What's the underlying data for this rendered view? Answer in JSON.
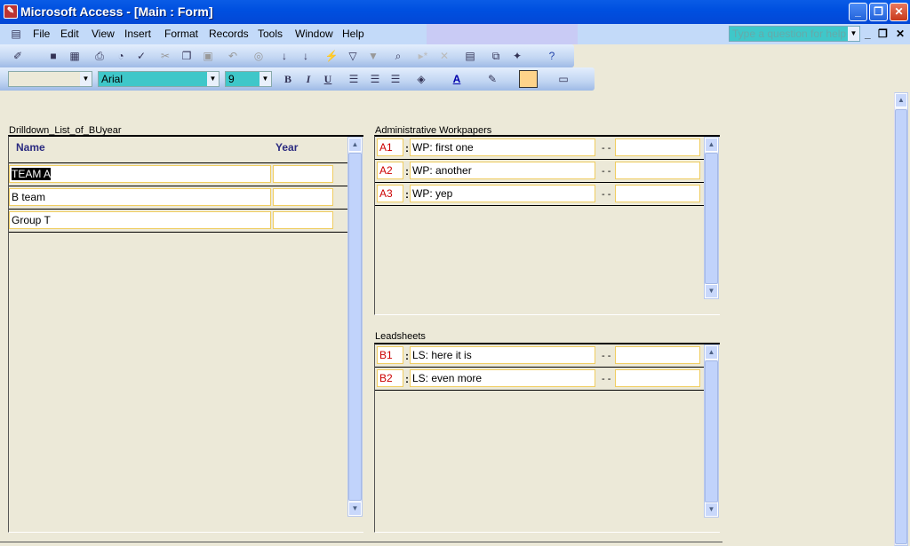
{
  "window": {
    "title": "Microsoft Access - [Main : Form]",
    "minimize": "_",
    "restore": "❐",
    "close": "✕"
  },
  "menu": {
    "items": [
      "File",
      "Edit",
      "View",
      "Insert",
      "Format",
      "Records",
      "Tools",
      "Window",
      "Help"
    ],
    "help_placeholder": "Type a question for help",
    "mdi_min": "_",
    "mdi_restore": "❐",
    "mdi_close": "✕"
  },
  "formatting": {
    "object": "",
    "font": "Arial",
    "size": "9",
    "bold": "B",
    "italic": "I",
    "underline": "U",
    "font_color_glyph": "A"
  },
  "drilldown": {
    "label": "Drilldown_List_of_BUyear",
    "col_name": "Name",
    "col_year": "Year",
    "rows": [
      {
        "name": "TEAM A",
        "year": ""
      },
      {
        "name": "B team",
        "year": ""
      },
      {
        "name": "Group T",
        "year": ""
      }
    ]
  },
  "admin": {
    "label": "Administrative Workpapers",
    "rows": [
      {
        "code": "A1",
        "desc": "WP: first one",
        "sep": "- -",
        "value": ""
      },
      {
        "code": "A2",
        "desc": "WP: another",
        "sep": "- -",
        "value": ""
      },
      {
        "code": "A3",
        "desc": "WP: yep",
        "sep": "- -",
        "value": ""
      }
    ]
  },
  "leads": {
    "label": "Leadsheets",
    "rows": [
      {
        "code": "B1",
        "desc": "LS: here it is",
        "sep": "- -",
        "value": ""
      },
      {
        "code": "B2",
        "desc": "LS: even more",
        "sep": "- -",
        "value": ""
      }
    ]
  },
  "colon": ":"
}
